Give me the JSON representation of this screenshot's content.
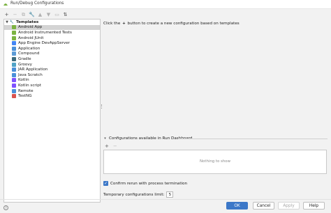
{
  "window": {
    "title": "Run/Debug Configurations"
  },
  "toolbar": {
    "buttons": [
      {
        "symbol": "+",
        "icon": "add-icon",
        "enabled": true
      },
      {
        "symbol": "−",
        "icon": "remove-icon",
        "enabled": false
      },
      {
        "symbol": "⧉",
        "icon": "copy-icon",
        "enabled": false
      },
      {
        "symbol": "🔧",
        "icon": "wrench-icon",
        "enabled": false
      },
      {
        "symbol": "▲",
        "icon": "move-up-icon",
        "enabled": false
      },
      {
        "symbol": "▼",
        "icon": "move-down-icon",
        "enabled": false
      },
      {
        "symbol": "▭",
        "icon": "folder-icon",
        "enabled": false
      },
      {
        "symbol": "⇅",
        "icon": "sort-icon",
        "enabled": true
      }
    ]
  },
  "tree": {
    "root": "Templates",
    "items": [
      {
        "label": "Android App",
        "icon": "android-icon",
        "color": "#7cb342",
        "selected": true
      },
      {
        "label": "Android Instrumented Tests",
        "icon": "android-icon",
        "color": "#7cb342"
      },
      {
        "label": "Android JUnit",
        "icon": "android-icon",
        "color": "#7cb342"
      },
      {
        "label": "App Engine DevAppServer",
        "icon": "app-engine-icon",
        "color": "#4285f4"
      },
      {
        "label": "Application",
        "icon": "application-icon",
        "color": "#4a90d9"
      },
      {
        "label": "Compound",
        "icon": "compound-icon",
        "color": "#5c9bd6"
      },
      {
        "label": "Gradle",
        "icon": "gradle-icon",
        "color": "#3d6b7d"
      },
      {
        "label": "Groovy",
        "icon": "groovy-icon",
        "color": "#4fa3c7"
      },
      {
        "label": "JAR Application",
        "icon": "jar-icon",
        "color": "#4a90d9"
      },
      {
        "label": "Java Scratch",
        "icon": "java-scratch-icon",
        "color": "#4a90d9"
      },
      {
        "label": "Kotlin",
        "icon": "kotlin-icon",
        "color": "#7f52ff"
      },
      {
        "label": "Kotlin script",
        "icon": "kotlin-script-icon",
        "color": "#7f52ff"
      },
      {
        "label": "Remote",
        "icon": "remote-icon",
        "color": "#4a90d9"
      },
      {
        "label": "TestNG",
        "icon": "testng-icon",
        "color": "#d9534f"
      }
    ]
  },
  "main": {
    "hint_before": "Click the",
    "hint_after": "button to create a new configuration based on templates"
  },
  "dashboard": {
    "title": "Configurations available in Run Dashboard",
    "add": "+",
    "remove": "−",
    "empty_text": "Nothing to show"
  },
  "options": {
    "confirm_rerun_label": "Confirm rerun with process termination",
    "confirm_rerun_checked": true,
    "temp_limit_label": "Temporary configurations limit:",
    "temp_limit_value": "5"
  },
  "footer": {
    "ok": "OK",
    "cancel": "Cancel",
    "apply": "Apply",
    "help": "Help"
  },
  "colors": {
    "accent": "#3c78c8",
    "selection": "#d4d4d4"
  }
}
